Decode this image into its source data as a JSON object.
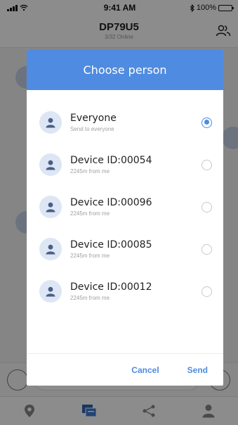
{
  "status_bar": {
    "time": "9:41 AM",
    "battery": "100%"
  },
  "header": {
    "title": "DP79U5",
    "subtitle": "3/32 Online"
  },
  "dialog": {
    "title": "Choose person",
    "options": [
      {
        "name": "Everyone",
        "detail": "Send to everyone",
        "selected": true
      },
      {
        "name": "Device ID:00054",
        "detail": "2245m from me",
        "selected": false
      },
      {
        "name": "Device ID:00096",
        "detail": "2245m from me",
        "selected": false
      },
      {
        "name": "Device ID:00085",
        "detail": "2245m from me",
        "selected": false
      },
      {
        "name": "Device ID:00012",
        "detail": "2245m from me",
        "selected": false
      }
    ],
    "cancel_label": "Cancel",
    "send_label": "Send"
  },
  "colors": {
    "accent": "#4f8be0",
    "avatar_bg": "#dde6f4",
    "avatar_fg": "#4a5f86"
  },
  "icons": {
    "status": [
      "signal-icon",
      "wifi-icon",
      "bluetooth-icon",
      "battery-icon"
    ],
    "header": "group-icon",
    "tabs": [
      "location-icon",
      "chat-icon",
      "share-icon",
      "profile-icon"
    ]
  }
}
